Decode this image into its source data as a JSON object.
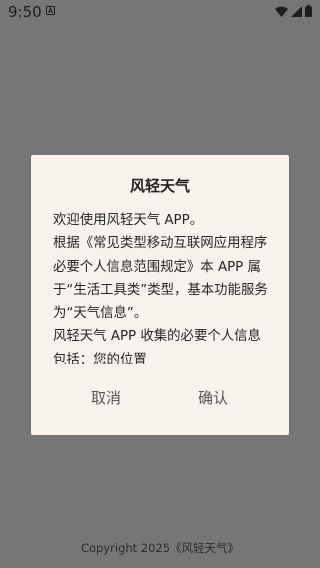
{
  "status_bar": {
    "time": "9:50",
    "notification_icon": "a-badge-icon",
    "icons": [
      "wifi-icon",
      "signal-icon",
      "battery-icon"
    ]
  },
  "dialog": {
    "title": "风轻天气",
    "paragraphs": [
      "欢迎使用风轻天气 APP。",
      "根据《常见类型移动互联网应用程序必要个人信息范围规定》本 APP 属于“生活工具类”类型，基本功能服务为“天气信息”。",
      "风轻天气 APP 收集的必要个人信息包括：您的位置"
    ],
    "cancel_label": "取消",
    "confirm_label": "确认"
  },
  "footer": {
    "copyright": "Copyright 2025《风轻天气》"
  },
  "colors": {
    "overlay": "#767676",
    "dialog_background": "#f7f2ec",
    "text": "#262626",
    "button_text": "#555555"
  }
}
